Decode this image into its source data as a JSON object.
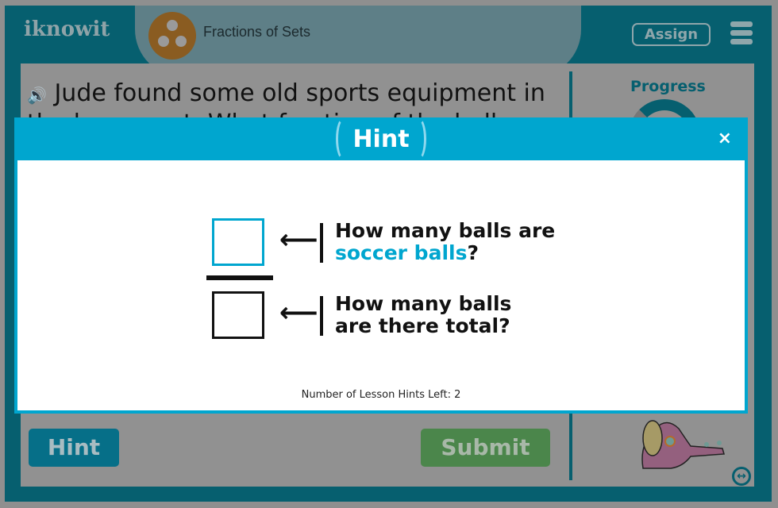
{
  "header": {
    "logo": "iknowit",
    "topic": "Fractions of Sets",
    "assign_label": "Assign"
  },
  "question": {
    "text": "Jude found some old sports equipment in the basement. What fraction of the balls"
  },
  "sidebar": {
    "progress_label": "Progress"
  },
  "buttons": {
    "hint": "Hint",
    "submit": "Submit"
  },
  "modal": {
    "title": "Hint",
    "close": "×",
    "numerator_label_1": "How many balls are",
    "numerator_highlight": "soccer balls",
    "numerator_end": "?",
    "denominator_line1": "How many balls",
    "denominator_line2": "are there total?",
    "arrow": "⟵",
    "hints_left": "Number of Lesson Hints Left: 2"
  },
  "colors": {
    "accent": "#00a6cf",
    "frame": "#065f6f",
    "submit": "#4b864b"
  }
}
